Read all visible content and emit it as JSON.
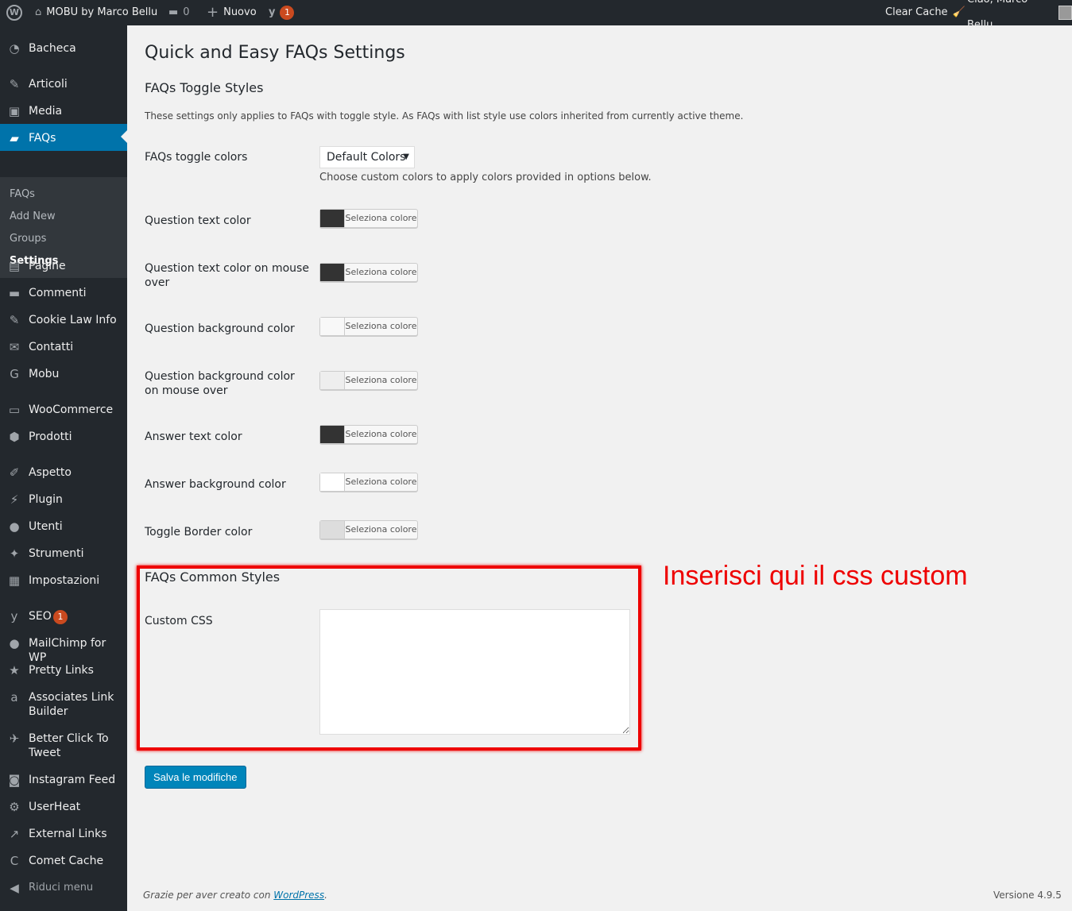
{
  "adminbar": {
    "site": "MOBU by Marco Bellu",
    "comments": "0",
    "new": "Nuovo",
    "seo_badge": "1",
    "clear_cache": "Clear Cache",
    "greeting": "Ciao, Marco Bellu"
  },
  "menu": [
    {
      "label": "Bacheca",
      "icon": "dashboard-icon",
      "glyph": "◔"
    },
    {
      "label": "Articoli",
      "icon": "pin-icon",
      "glyph": "✎"
    },
    {
      "label": "Media",
      "icon": "media-icon",
      "glyph": "▣"
    },
    {
      "label": "FAQs",
      "icon": "faq-icon",
      "glyph": "▰",
      "active": true
    },
    {
      "label": "Pagine",
      "icon": "page-icon",
      "glyph": "▤"
    },
    {
      "label": "Commenti",
      "icon": "comment-icon",
      "glyph": "▬"
    },
    {
      "label": "Cookie Law Info",
      "icon": "pin-icon",
      "glyph": "✎"
    },
    {
      "label": "Contatti",
      "icon": "mail-icon",
      "glyph": "✉"
    },
    {
      "label": "Mobu",
      "icon": "mobu-icon",
      "glyph": "G"
    },
    {
      "label": "WooCommerce",
      "icon": "woo-icon",
      "glyph": "▭"
    },
    {
      "label": "Prodotti",
      "icon": "box-icon",
      "glyph": "⬢"
    },
    {
      "label": "Aspetto",
      "icon": "brush-icon",
      "glyph": "✐"
    },
    {
      "label": "Plugin",
      "icon": "plugin-icon",
      "glyph": "⚡"
    },
    {
      "label": "Utenti",
      "icon": "user-icon",
      "glyph": "●"
    },
    {
      "label": "Strumenti",
      "icon": "wrench-icon",
      "glyph": "✦"
    },
    {
      "label": "Impostazioni",
      "icon": "settings-icon",
      "glyph": "▦"
    },
    {
      "label": "SEO",
      "icon": "yoast-icon",
      "glyph": "y",
      "badge": "1"
    },
    {
      "label": "MailChimp for WP",
      "icon": "mailchimp-icon",
      "glyph": "●"
    },
    {
      "label": "Pretty Links",
      "icon": "star-icon",
      "glyph": "★"
    },
    {
      "label": "Associates Link Builder",
      "icon": "amazon-icon",
      "glyph": "a"
    },
    {
      "label": "Better Click To Tweet",
      "icon": "twitter-icon",
      "glyph": "✈"
    },
    {
      "label": "Instagram Feed",
      "icon": "camera-icon",
      "glyph": "◙"
    },
    {
      "label": "UserHeat",
      "icon": "gear-icon",
      "glyph": "⚙"
    },
    {
      "label": "External Links",
      "icon": "external-icon",
      "glyph": "↗"
    },
    {
      "label": "Comet Cache",
      "icon": "comet-icon",
      "glyph": "C"
    },
    {
      "label": "Riduci menu",
      "icon": "collapse-icon",
      "glyph": "◀"
    }
  ],
  "submenu": [
    "FAQs",
    "Add New",
    "Groups",
    "Settings"
  ],
  "page": {
    "title": "Quick and Easy FAQs Settings",
    "toggle_heading": "FAQs Toggle Styles",
    "toggle_desc": "These settings only applies to FAQs with toggle style. As FAQs with list style use colors inherited from currently active theme.",
    "toggle_colors_label": "FAQs toggle colors",
    "toggle_colors_value": "Default Colors",
    "toggle_colors_desc": "Choose custom colors to apply colors provided in options below.",
    "picker_label": "Seleziona colore",
    "colors": [
      {
        "label": "Question text color",
        "color": "#333333"
      },
      {
        "label": "Question text color on mouse over",
        "color": "#333333"
      },
      {
        "label": "Question background color",
        "color": "#f8f8f8"
      },
      {
        "label": "Question background color on mouse over",
        "color": "#eeeeee"
      },
      {
        "label": "Answer text color",
        "color": "#333333"
      },
      {
        "label": "Answer background color",
        "color": "#ffffff"
      },
      {
        "label": "Toggle Border color",
        "color": "#dddddd"
      }
    ],
    "common_heading": "FAQs Common Styles",
    "custom_css_label": "Custom CSS",
    "custom_css_value": "",
    "save": "Salva le modifiche",
    "annotation": "Inserisci qui il css custom"
  },
  "footer": {
    "thanks": "Grazie per aver creato con ",
    "link": "WordPress",
    "version": "Versione 4.9.5"
  }
}
